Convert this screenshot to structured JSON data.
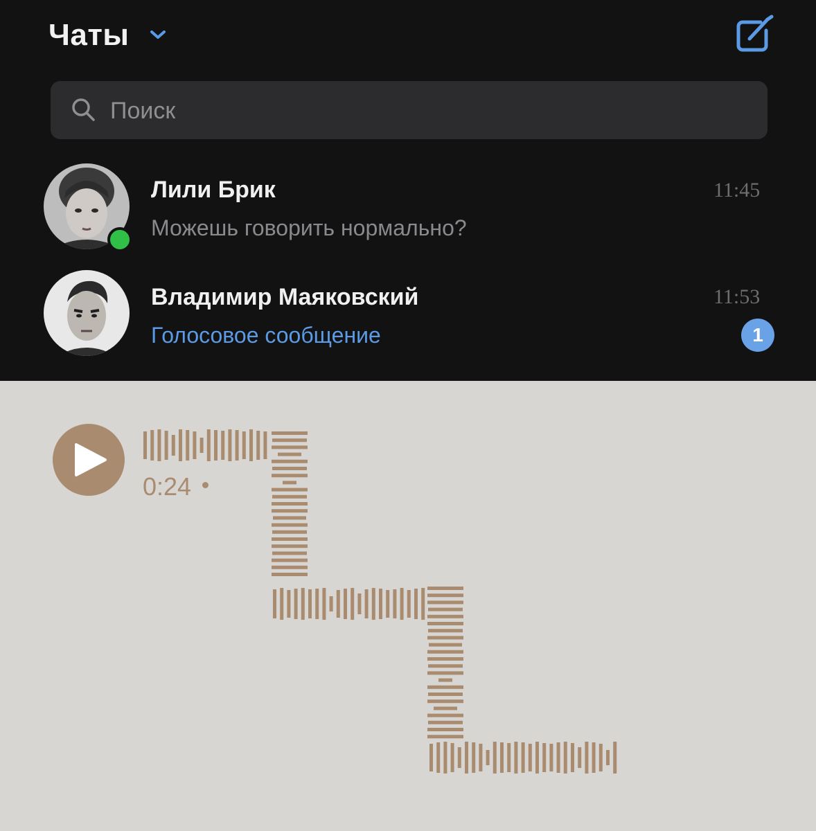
{
  "header": {
    "title": "Чаты",
    "title_caret_icon": "chevron-down-icon",
    "compose_icon": "compose-icon",
    "accent": "#5b9be6"
  },
  "search": {
    "placeholder": "Поиск",
    "icon": "search-icon"
  },
  "chats": [
    {
      "name": "Лили Брик",
      "preview": "Можешь говорить нормально?",
      "time": "11:45",
      "online": true,
      "unread": null
    },
    {
      "name": "Владимир Маяковский",
      "preview": "Голосовое сообщение",
      "time": "11:53",
      "online": false,
      "unread": "1"
    }
  ],
  "voice_message": {
    "duration": "0:24",
    "play_icon": "play-icon",
    "accent": "#a98b6f",
    "background": "#d8d6d3"
  }
}
